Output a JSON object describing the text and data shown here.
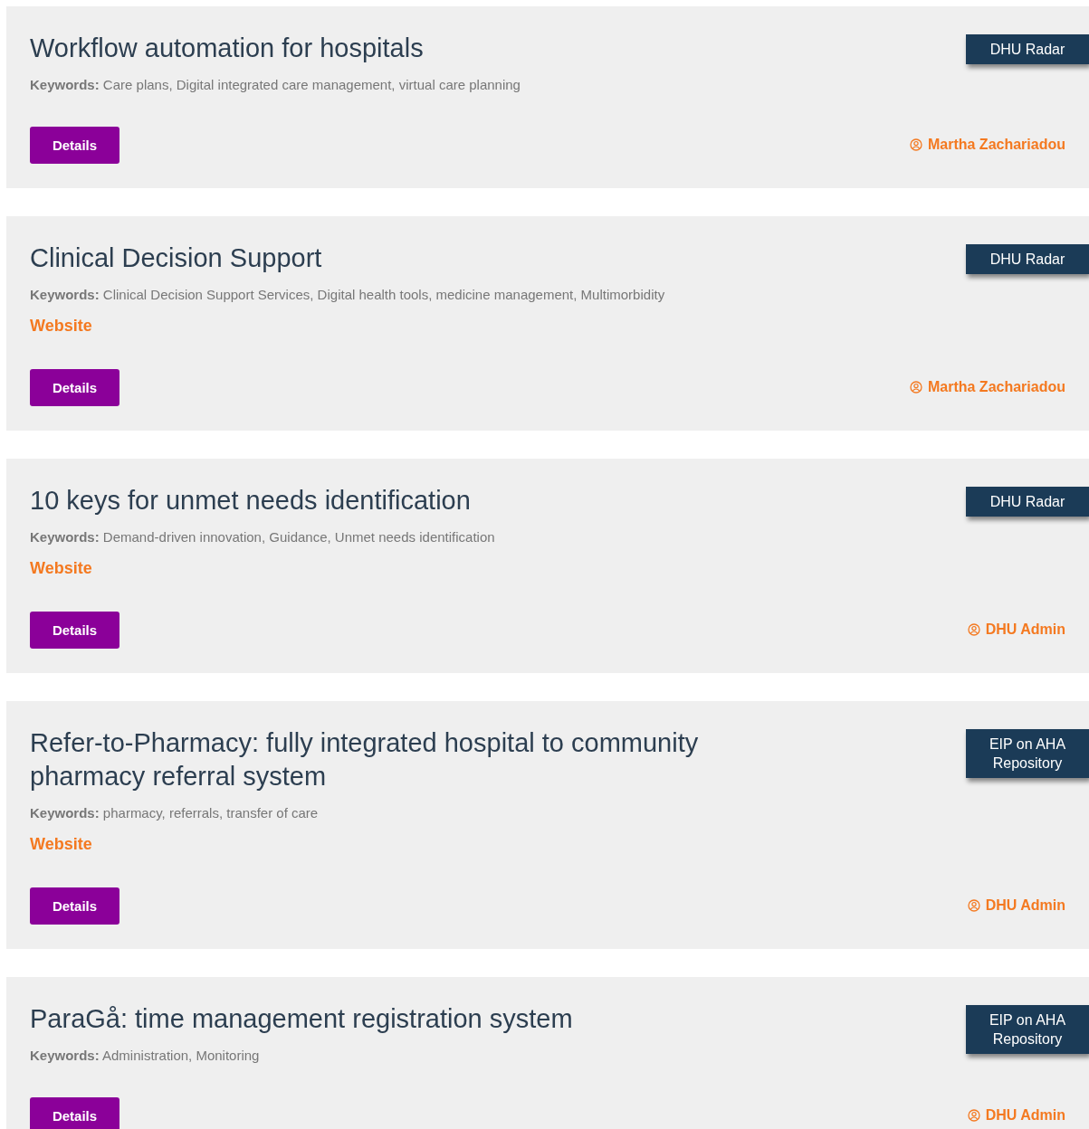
{
  "cards": [
    {
      "title": "Workflow automation for hospitals",
      "keywords": "**Keywords:** Care plans, Digital integrated care management, virtual care planning",
      "badge": "DHU Radar",
      "button": "Details",
      "author": "Martha Zachariadou"
    },
    {
      "title": "Clinical Decision Support",
      "keywords": "**Keywords:** Clinical Decision Support Services, Digital health tools, medicine management, Multimorbidity",
      "website": "Website",
      "badge": "DHU Radar",
      "button": "Details",
      "author": "Martha Zachariadou"
    },
    {
      "title": "10 keys for unmet needs identification",
      "keywords": "**Keywords:** Demand-driven innovation, Guidance, Unmet needs identification",
      "website": "Website",
      "badge": "DHU Radar",
      "button": "Details",
      "author": "DHU Admin"
    },
    {
      "title": "Refer-to-Pharmacy: fully integrated hospital to community pharmacy referral system",
      "keywords": "**Keywords:** pharmacy, referrals, transfer of care",
      "website": "Website",
      "badge": "EIP on AHA Repository",
      "button": "Details",
      "author": "DHU Admin"
    },
    {
      "title": "ParaGå: time management registration system",
      "keywords": "**Keywords:** Administration, Monitoring",
      "badge": "EIP on AHA Repository",
      "button": "Details",
      "author": "DHU Admin"
    }
  ]
}
